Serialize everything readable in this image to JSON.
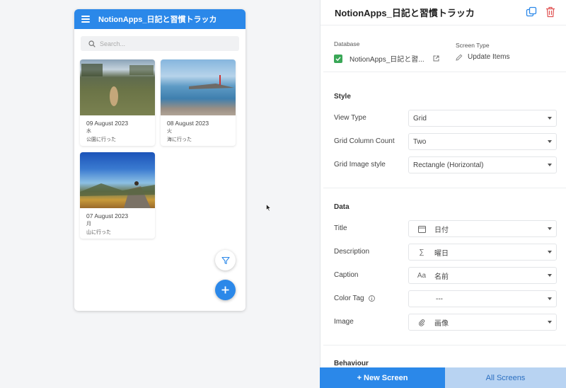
{
  "app": {
    "title": "NotionApps_日記と習慣トラッカ",
    "search_placeholder": "Search...",
    "cards": [
      {
        "date": "09 August 2023",
        "weekday": "水",
        "caption": "公園に行った"
      },
      {
        "date": "08 August 2023",
        "weekday": "火",
        "caption": "海に行った"
      },
      {
        "date": "07 August 2023",
        "weekday": "月",
        "caption": "山に行った"
      }
    ]
  },
  "panel": {
    "title": "NotionApps_日記と習慣トラッカ",
    "database_label": "Database",
    "database_value": "NotionApps_日記と習...",
    "screen_type_label": "Screen Type",
    "screen_type_value": "Update Items",
    "style": {
      "heading": "Style",
      "view_type_label": "View Type",
      "view_type_value": "Grid",
      "grid_column_label": "Grid Column Count",
      "grid_column_value": "Two",
      "grid_image_label": "Grid Image style",
      "grid_image_value": "Rectangle (Horizontal)"
    },
    "data": {
      "heading": "Data",
      "title_label": "Title",
      "title_value": "日付",
      "description_label": "Description",
      "description_value": "曜日",
      "caption_label": "Caption",
      "caption_value": "名前",
      "color_tag_label": "Color Tag",
      "color_tag_value": "---",
      "image_label": "Image",
      "image_value": "画像"
    },
    "behaviour_heading": "Behaviour",
    "new_screen": "+ New Screen",
    "all_screens": "All Screens"
  },
  "colors": {
    "accent": "#2b88e9",
    "check": "#3aa757",
    "delete": "#e05252"
  }
}
